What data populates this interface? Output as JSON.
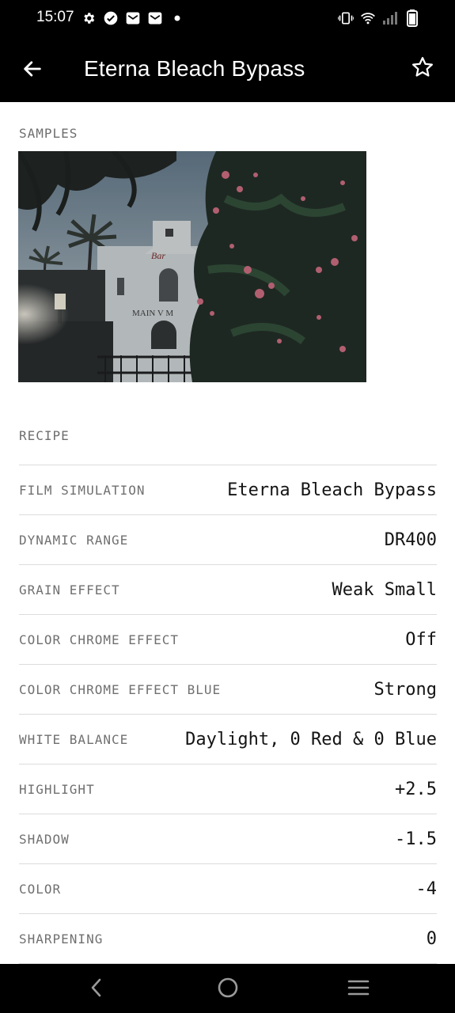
{
  "status_bar": {
    "time": "15:07",
    "left_icons": [
      "settings-icon",
      "check-circle-icon",
      "mail-icon",
      "mail-icon",
      "dot-icon"
    ],
    "right_icons": [
      "vibrate-icon",
      "wifi-icon",
      "signal-icon",
      "battery-icon"
    ]
  },
  "app_bar": {
    "title": "Eterna Bleach Bypass",
    "back_icon": "arrow-back-icon",
    "favorite_icon": "star-outline-icon"
  },
  "samples": {
    "label": "SAMPLES"
  },
  "recipe": {
    "label": "RECIPE",
    "rows": [
      {
        "label": "FILM SIMULATION",
        "value": "Eterna Bleach Bypass"
      },
      {
        "label": "DYNAMIC RANGE",
        "value": "DR400"
      },
      {
        "label": "GRAIN EFFECT",
        "value": "Weak Small"
      },
      {
        "label": "COLOR CHROME EFFECT",
        "value": "Off"
      },
      {
        "label": "COLOR CHROME EFFECT BLUE",
        "value": "Strong"
      },
      {
        "label": "WHITE BALANCE",
        "value": "Daylight, 0 Red & 0 Blue"
      },
      {
        "label": "HIGHLIGHT",
        "value": "+2.5"
      },
      {
        "label": "SHADOW",
        "value": "-1.5"
      },
      {
        "label": "COLOR",
        "value": "-4"
      },
      {
        "label": "SHARPENING",
        "value": "0"
      }
    ]
  },
  "nav_bar": {
    "buttons": [
      "nav-back-icon",
      "home-icon",
      "recents-icon"
    ]
  },
  "colors": {
    "bar_background": "#000000",
    "label_gray": "#707070",
    "value_text": "#141414",
    "divider": "#dcdcdc"
  }
}
